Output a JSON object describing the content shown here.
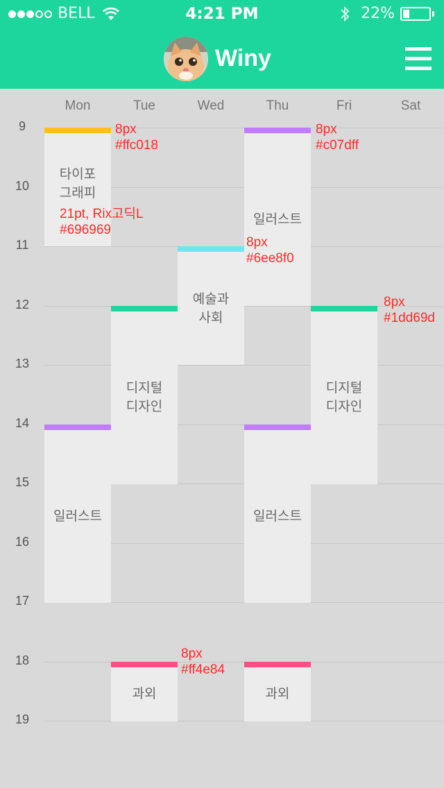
{
  "status_bar": {
    "signal_filled": 3,
    "signal_total": 5,
    "carrier": "BELL",
    "time": "4:21 PM",
    "battery_text": "22%",
    "battery_level": 0.22
  },
  "header": {
    "title": "Winy",
    "avatar_icon": "cat-avatar",
    "menu_icon": "hamburger-menu-icon",
    "background": "#1dd69d"
  },
  "days": [
    "Mon",
    "Tue",
    "Wed",
    "Thu",
    "Fri",
    "Sat"
  ],
  "hours": [
    "9",
    "10",
    "11",
    "12",
    "13",
    "14",
    "15",
    "16",
    "17",
    "18",
    "19"
  ],
  "events": [
    {
      "day": "Mon",
      "start": 9,
      "end": 11,
      "title": "타이포\n그래피",
      "color": "#ffc018"
    },
    {
      "day": "Mon",
      "start": 14,
      "end": 17,
      "title": "일러스트",
      "color": "#c07dff"
    },
    {
      "day": "Tue",
      "start": 12,
      "end": 15,
      "title": "디지털\n디자인",
      "color": "#1dd69d"
    },
    {
      "day": "Tue",
      "start": 18,
      "end": 19,
      "title": "과외",
      "color": "#ff4e84"
    },
    {
      "day": "Wed",
      "start": 11,
      "end": 13,
      "title": "예술과\n사회",
      "color": "#6ee8f0"
    },
    {
      "day": "Thu",
      "start": 9,
      "end": 12,
      "title": "일러스트",
      "color": "#c07dff"
    },
    {
      "day": "Thu",
      "start": 14,
      "end": 17,
      "title": "일러스트",
      "color": "#c07dff"
    },
    {
      "day": "Thu",
      "start": 18,
      "end": 19,
      "title": "과외",
      "color": "#ff4e84"
    },
    {
      "day": "Fri",
      "start": 12,
      "end": 15,
      "title": "디지털\n디자인",
      "color": "#1dd69d"
    }
  ],
  "annotations": {
    "yellow": "8px\n#ffc018",
    "font_spec": "21pt, Rix고딕L\n#696969",
    "purple": "8px\n#c07dff",
    "cyan": "8px\n#6ee8f0",
    "green": "8px\n#1dd69d",
    "pink": "8px\n#ff4e84"
  }
}
